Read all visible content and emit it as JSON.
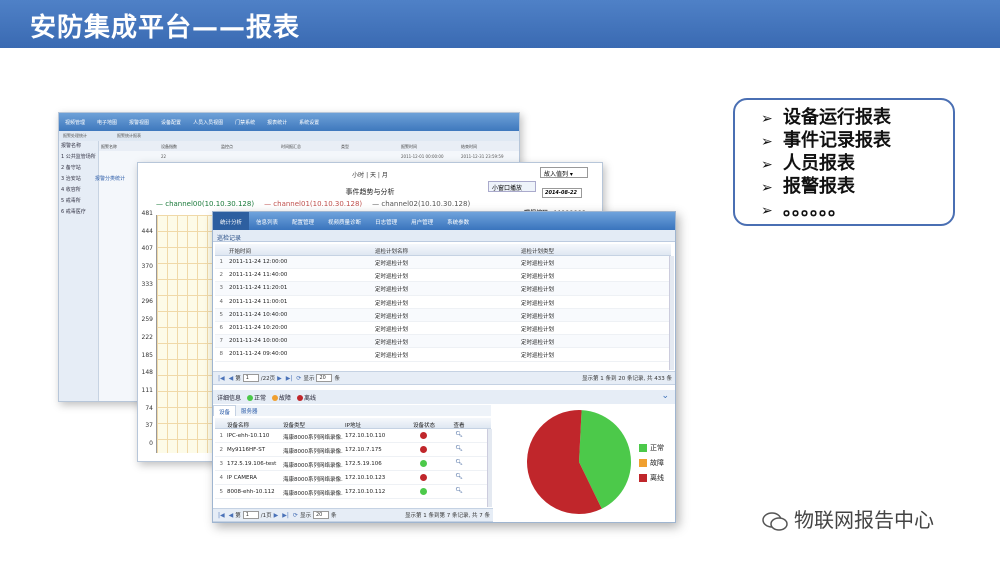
{
  "title": "安防集成平台——报表",
  "bullets": [
    "设备运行报表",
    "事件记录报表",
    "人员报表",
    "报警报表",
    "。。。。。。"
  ],
  "watermark": "物联网报告中心",
  "win1": {
    "menu": [
      "视频管理",
      "电子地图",
      "报警视图",
      "设备配置",
      "人员入员视图",
      "门禁系统",
      "报表统计",
      "系统设置"
    ],
    "breadcrumb": [
      "报警处理统计",
      "报警统计报表"
    ],
    "sidebar": [
      "报警名称",
      "1 公共监管场所",
      "2 备守站",
      "3 治安站",
      "4 收容所",
      "5 戒毒所",
      "6 戒毒医疗"
    ],
    "grid_header": [
      "报警名称",
      "设备指数",
      "监控点",
      "时间报汇总",
      "类型",
      "报警时间",
      "结束时间"
    ],
    "grid_row": [
      "",
      "22",
      "",
      "",
      "",
      "2011-12-01 00:00:00",
      "2011-12-31 23:59:59"
    ],
    "tab": "报警分类统计"
  },
  "win2": {
    "timescale": "小时 | 天 | 月",
    "dropdown": "故入值列",
    "popout": "小窗口播放",
    "date": "2014-08-22",
    "info": "曝报编码: 44000001",
    "chart_title": "事件趋势与分析",
    "legend": [
      "channel00(10.10.30.128)",
      "channel01(10.10.30.128)",
      "channel02(10.10.30.128)"
    ],
    "yticks": [
      "481",
      "444",
      "407",
      "370",
      "333",
      "296",
      "259",
      "222",
      "185",
      "148",
      "111",
      "74",
      "37",
      "0"
    ]
  },
  "win3": {
    "menu": [
      "统计分析",
      "信息列表",
      "配置管理",
      "视频质量诊断",
      "日志管理",
      "用户管理",
      "系统参数"
    ],
    "subheader": "巡检记录",
    "columns": [
      "开始时间",
      "巡检计划名称",
      "巡检计划类型"
    ],
    "rows": [
      [
        "1",
        "2011-11-24 12:00:00",
        "定时巡检计划",
        "定时巡检计划"
      ],
      [
        "2",
        "2011-11-24 11:40:00",
        "定时巡检计划",
        "定时巡检计划"
      ],
      [
        "3",
        "2011-11-24 11:20:01",
        "定时巡检计划",
        "定时巡检计划"
      ],
      [
        "4",
        "2011-11-24 11:00:01",
        "定时巡检计划",
        "定时巡检计划"
      ],
      [
        "5",
        "2011-11-24 10:40:00",
        "定时巡检计划",
        "定时巡检计划"
      ],
      [
        "6",
        "2011-11-24 10:20:00",
        "定时巡检计划",
        "定时巡检计划"
      ],
      [
        "7",
        "2011-11-24 10:00:00",
        "定时巡检计划",
        "定时巡检计划"
      ],
      [
        "8",
        "2011-11-24 09:40:00",
        "定时巡检计划",
        "定时巡检计划"
      ]
    ],
    "pager1": {
      "page_prefix": "第",
      "page": "1",
      "page_suffix": "/22页",
      "show": "显示",
      "size": "20",
      "unit": "条",
      "summary": "显示第 1 条到 20 条记录, 共 433 条"
    },
    "detail_title": "详细信息",
    "status_legend": [
      "正常",
      "故障",
      "离线"
    ],
    "detail_tabs": [
      "设备",
      "服务器"
    ],
    "detail_columns": [
      "设备名称",
      "设备类型",
      "IP地址",
      "设备状态",
      "查看"
    ],
    "devices": [
      [
        "1",
        "IPC-ehh-10.110",
        "海康8000系列网络录像...",
        "172.10.10.110",
        "red"
      ],
      [
        "2",
        "My9116HF-ST",
        "海康8000系列网络录像...",
        "172.10.7.175",
        "red"
      ],
      [
        "3",
        "172.5.19.106-test",
        "海康8000系列网络录像...",
        "172.5.19.106",
        "green"
      ],
      [
        "4",
        "IP CAMERA",
        "海康8000系列网络录像...",
        "172.10.10.123",
        "red"
      ],
      [
        "5",
        "8008-ehh-10.112",
        "海康8000系列网络录像...",
        "172.10.10.112",
        "green"
      ]
    ],
    "view_icon": "magnifier-icon",
    "pager2": {
      "page_prefix": "第",
      "page": "1",
      "page_suffix": "/1页",
      "show": "显示",
      "size": "20",
      "unit": "条",
      "summary": "显示第 1 条到第 7 条记录, 共 7 条"
    },
    "pie_legend": [
      "正常",
      "故障",
      "离线"
    ]
  },
  "colors": {
    "title_bg": "#3f6fb5",
    "normal": "#4cc94a",
    "fault": "#f0a030",
    "offline": "#c0262b",
    "menu_blue": "#3974bd"
  },
  "chart_data": {
    "type": "pie",
    "categories": [
      "正常",
      "故障",
      "离线"
    ],
    "values": [
      42,
      0,
      58
    ]
  }
}
